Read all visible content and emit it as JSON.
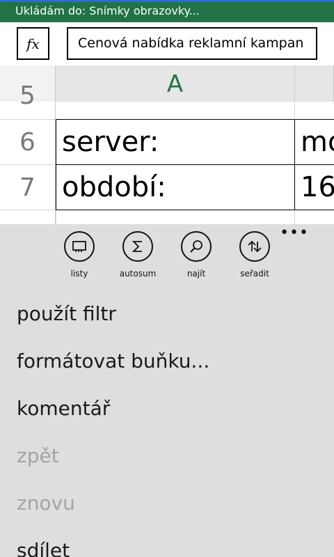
{
  "status_bar": {
    "text": "Ukládám do: Snímky obrazovky..."
  },
  "formula_bar": {
    "fx_label": "fx",
    "value": "Cenová nabídka reklamní kampan"
  },
  "grid": {
    "column_header": "A",
    "rows": [
      {
        "number": "5",
        "cells": [
          "",
          ""
        ]
      },
      {
        "number": "6",
        "cells": [
          "server:",
          "mo"
        ]
      },
      {
        "number": "7",
        "cells": [
          "období:",
          "16"
        ]
      }
    ]
  },
  "app_bar": {
    "more": "•••",
    "buttons": [
      {
        "label": "listy",
        "icon": "sheets-icon"
      },
      {
        "label": "autosum",
        "icon": "sigma-icon"
      },
      {
        "label": "najít",
        "icon": "search-icon"
      },
      {
        "label": "seřadit",
        "icon": "sort-icon"
      }
    ],
    "menu": [
      {
        "label": "použít filtr",
        "enabled": true
      },
      {
        "label": "formátovat buňku...",
        "enabled": true
      },
      {
        "label": "komentář",
        "enabled": true
      },
      {
        "label": "zpět",
        "enabled": false
      },
      {
        "label": "znovu",
        "enabled": false
      },
      {
        "label": "sdílet",
        "enabled": true
      }
    ]
  },
  "colors": {
    "status_bar_bg": "#217346",
    "column_header_text": "#217346",
    "app_bar_bg": "#dedede",
    "disabled_text": "#a4a4a4"
  }
}
